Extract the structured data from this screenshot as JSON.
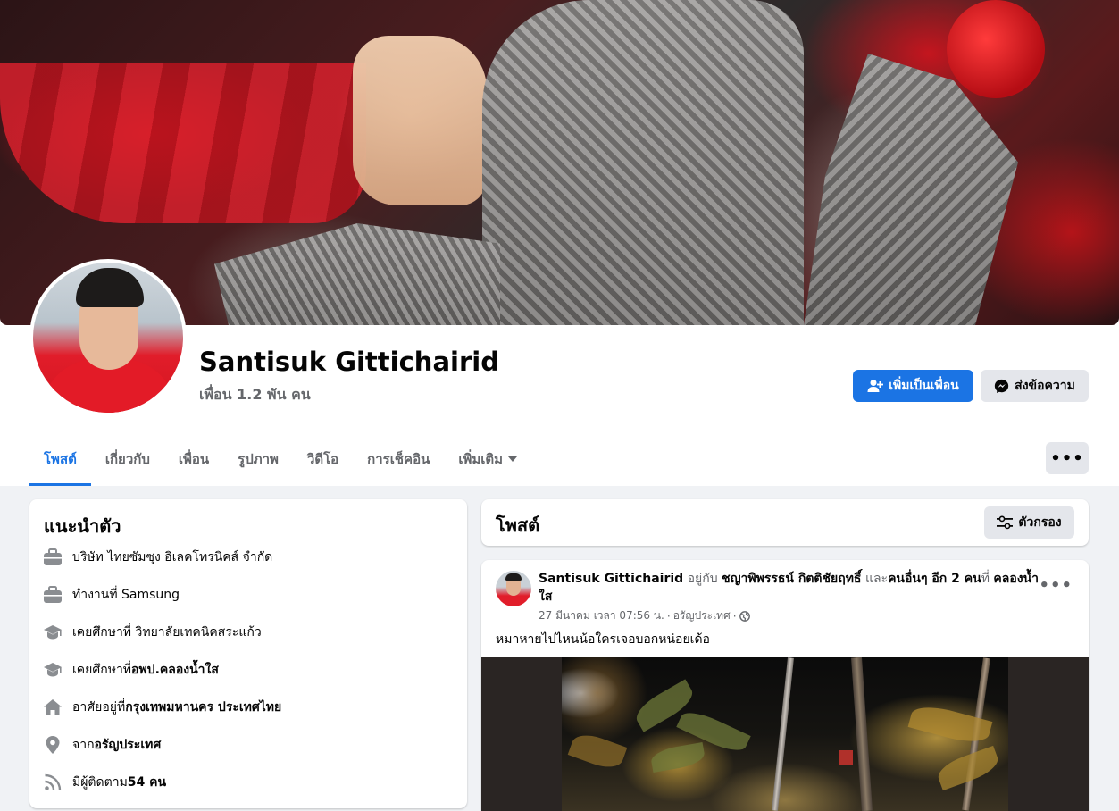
{
  "profile": {
    "name": "Santisuk Gittichairid",
    "friends": "เพื่อน 1.2 พัน คน",
    "add_friend_label": "เพิ่มเป็นเพื่อน",
    "message_label": "ส่งข้อความ"
  },
  "tabs": [
    {
      "label": "โพสต์",
      "active": true
    },
    {
      "label": "เกี่ยวกับ",
      "active": false
    },
    {
      "label": "เพื่อน",
      "active": false
    },
    {
      "label": "รูปภาพ",
      "active": false
    },
    {
      "label": "วิดีโอ",
      "active": false
    },
    {
      "label": "การเช็คอิน",
      "active": false
    },
    {
      "label": "เพิ่มเติม",
      "active": false
    }
  ],
  "more_menu": "•••",
  "intro": {
    "title": "แนะนำตัว",
    "items": [
      {
        "icon": "briefcase-icon",
        "prefix": "บริษัท ไทยซัมซุง อิเลคโทรนิคส์ จำกัด",
        "value": ""
      },
      {
        "icon": "briefcase-icon",
        "prefix": "ทำงานที่ Samsung",
        "value": ""
      },
      {
        "icon": "graduation-cap-icon",
        "prefix": "เคยศึกษาที่ วิทยาลัยเทคนิคสระแก้ว",
        "value": ""
      },
      {
        "icon": "graduation-cap-icon",
        "prefix": "เคยศึกษาที่ ",
        "value": "อพป.คลองน้ำใส"
      },
      {
        "icon": "home-icon",
        "prefix": "อาศัยอยู่ที่ ",
        "value": "กรุงเทพมหานคร ประเทศไทย"
      },
      {
        "icon": "location-pin-icon",
        "prefix": "จาก ",
        "value": "อรัญประเทศ"
      },
      {
        "icon": "rss-feed-icon",
        "prefix": "มีผู้ติดตาม ",
        "value": "54 คน"
      }
    ]
  },
  "posts": {
    "title": "โพสต์",
    "filter_label": "ตัวกรอง"
  },
  "post": {
    "author": "Santisuk Gittichairid",
    "with_word": "อยู่กับ",
    "tagged": "ชญาพิพรรธน์ กิตติชัยฤทธิ์",
    "and_word": "และ",
    "others": "คนอื่นๆ อีก 2 คน",
    "at_word": "ที่",
    "place": "คลองน้ำใส",
    "time": "27 มีนาคม เวลา 07:56 น.",
    "sep": "·",
    "location": "อรัญประเทศ",
    "text": "หมาหายไปไหนน้อใครเจอบอกหน่อยเด้อ"
  },
  "colors": {
    "accent": "#1b74e4",
    "background": "#f0f2f5",
    "secondary_text": "#65676b"
  }
}
